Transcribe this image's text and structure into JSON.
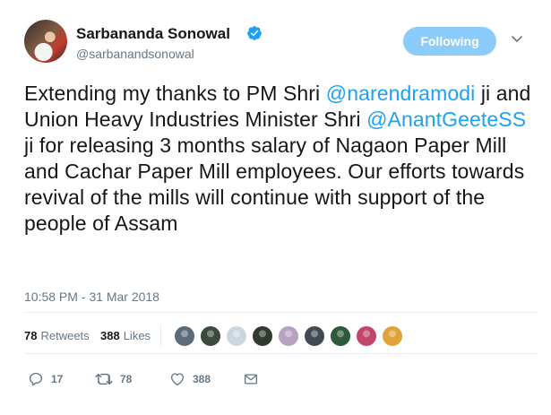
{
  "author": {
    "display_name": "Sarbananda Sonowal",
    "handle": "@sarbanandsonowal",
    "verified": true,
    "verified_icon": "verified-badge-icon"
  },
  "follow_button": {
    "label": "Following"
  },
  "caret_icon": "chevron-down-icon",
  "tweet": {
    "part1": "Extending my thanks to PM Shri ",
    "mention1": "@narendramodi",
    "part2": " ji and Union Heavy Industries Minister Shri ",
    "mention2": "@AnantGeeteSS",
    "part3": " ji for releasing 3 months salary of Nagaon Paper Mill and Cachar Paper Mill employees. Our efforts towards revival of the mills will continue with support of the people of Assam"
  },
  "timestamp": "10:58 PM - 31 Mar 2018",
  "stats": {
    "retweets_count": "78",
    "retweets_label": "Retweets",
    "likes_count": "388",
    "likes_label": "Likes"
  },
  "likers": [
    {
      "color": "#5a6b7a"
    },
    {
      "color": "#3b4a3c"
    },
    {
      "color": "#ccd6dd"
    },
    {
      "color": "#2f3b2f"
    },
    {
      "color": "#b7a2c4"
    },
    {
      "color": "#3f4a55"
    },
    {
      "color": "#2d5a3a"
    },
    {
      "color": "#c2456a"
    },
    {
      "color": "#e0a33a"
    }
  ],
  "actions": {
    "reply_count": "17",
    "retweet_count": "78",
    "like_count": "388",
    "reply_icon": "reply-icon",
    "retweet_icon": "retweet-icon",
    "like_icon": "heart-icon",
    "dm_icon": "envelope-icon"
  },
  "colors": {
    "accent": "#1da1f2",
    "follow_button": "#8cccfa",
    "secondary_text": "#657786"
  }
}
